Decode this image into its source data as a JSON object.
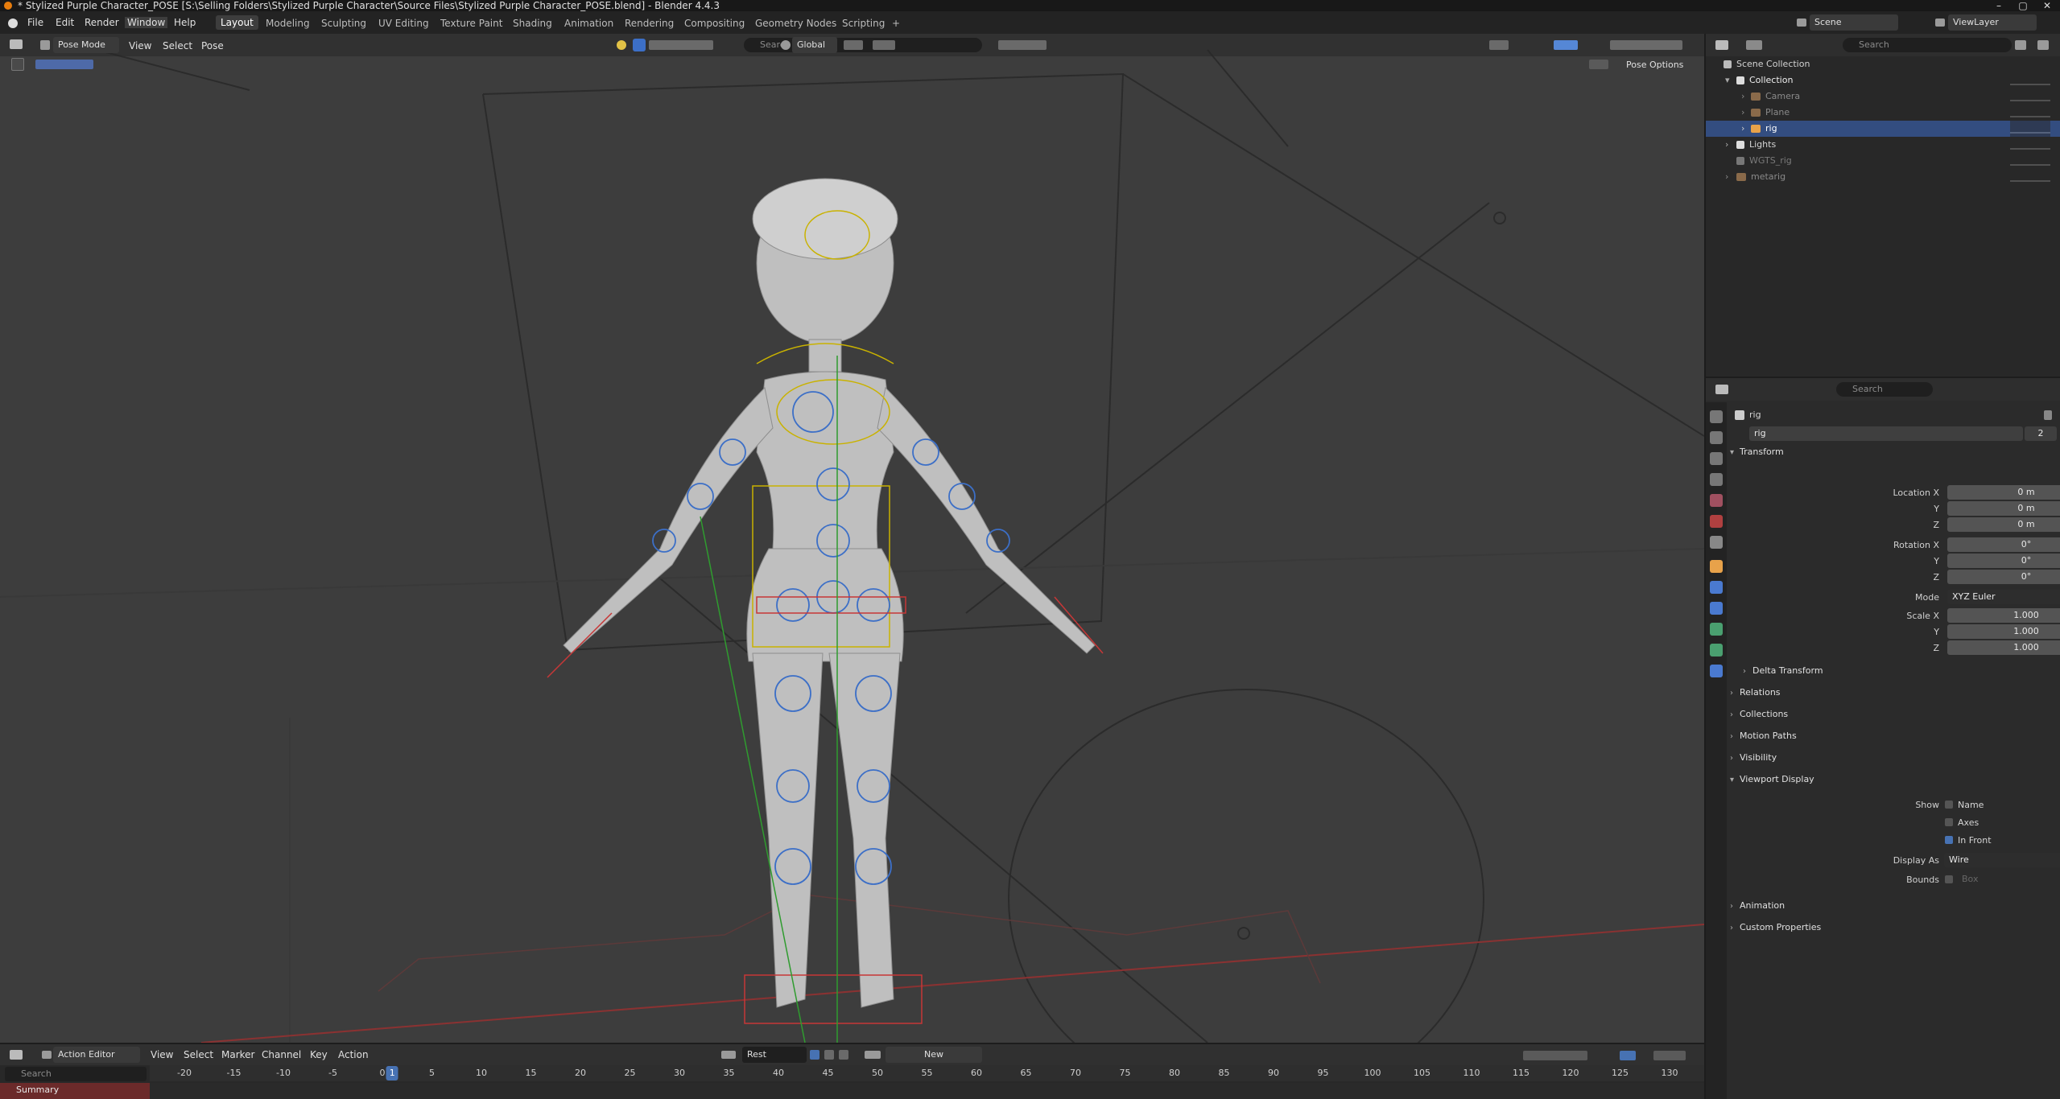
{
  "window": {
    "title": "* Stylized Purple Character_POSE [S:\\Selling Folders\\Stylized Purple Character\\Source Files\\Stylized Purple Character_POSE.blend] - Blender 4.4.3",
    "controls": [
      "–",
      "▢",
      "✕"
    ]
  },
  "menu": [
    "File",
    "Edit",
    "Render",
    "Window",
    "Help"
  ],
  "workspaces": [
    "Layout",
    "Modeling",
    "Sculpting",
    "UV Editing",
    "Texture Paint",
    "Shading",
    "Animation",
    "Rendering",
    "Compositing",
    "Geometry Nodes",
    "Scripting",
    "+"
  ],
  "active_workspace": "Layout",
  "scene": {
    "label": "Scene",
    "view_layer": "ViewLayer"
  },
  "viewport": {
    "mode": "Pose Mode",
    "menus": [
      "View",
      "Select",
      "Pose"
    ],
    "transform_orientation": "Global",
    "search_placeholder": "Search",
    "pose_options": "Pose Options"
  },
  "outliner": {
    "search_placeholder": "Search",
    "rows": [
      {
        "label": "Scene Collection",
        "indent": 0
      },
      {
        "label": "Collection",
        "indent": 1
      },
      {
        "label": "Camera",
        "indent": 2
      },
      {
        "label": "Plane",
        "indent": 2
      },
      {
        "label": "rig",
        "indent": 2,
        "selected": true
      },
      {
        "label": "Lights",
        "indent": 1
      },
      {
        "label": "WGTS_rig",
        "indent": 1
      },
      {
        "label": "metarig",
        "indent": 1
      }
    ]
  },
  "properties": {
    "search_placeholder": "Search",
    "object_name": "rig",
    "data_name": "rig",
    "users": "2",
    "transform_header": "Transform",
    "location_label": "Location X",
    "rotation_label": "Rotation X",
    "scale_label": "Scale X",
    "y_label": "Y",
    "z_label": "Z",
    "location": [
      "0 m",
      "0 m",
      "0 m"
    ],
    "rotation": [
      "0°",
      "0°",
      "0°"
    ],
    "mode_label": "Mode",
    "mode_value": "XYZ Euler",
    "scale": [
      "1.000",
      "1.000",
      "1.000"
    ],
    "delta_transform": "Delta Transform",
    "panels_collapsed": [
      "Relations",
      "Collections",
      "Motion Paths",
      "Visibility"
    ],
    "viewport_display": "Viewport Display",
    "show_label": "Show",
    "show_name": "Name",
    "show_axes": "Axes",
    "show_in_front": "In Front",
    "display_as_label": "Display As",
    "display_as_value": "Wire",
    "bounds_label": "Bounds",
    "bounds_value": "Box",
    "panels_after": [
      "Animation",
      "Custom Properties"
    ]
  },
  "timeline": {
    "editor": "Action Editor",
    "menus": [
      "View",
      "Select",
      "Marker",
      "Channel",
      "Key",
      "Action"
    ],
    "slot": "Rest",
    "new_label": "New",
    "search_placeholder": "Search",
    "summary": "Summary",
    "current_frame": "1",
    "ticks": [
      "-20",
      "-15",
      "-10",
      "-5",
      "0",
      "5",
      "10",
      "15",
      "20",
      "25",
      "30",
      "35",
      "40",
      "45",
      "50",
      "55",
      "60",
      "65",
      "70",
      "75",
      "80",
      "85",
      "90",
      "95",
      "100",
      "105",
      "110",
      "115",
      "120",
      "125",
      "130"
    ]
  }
}
